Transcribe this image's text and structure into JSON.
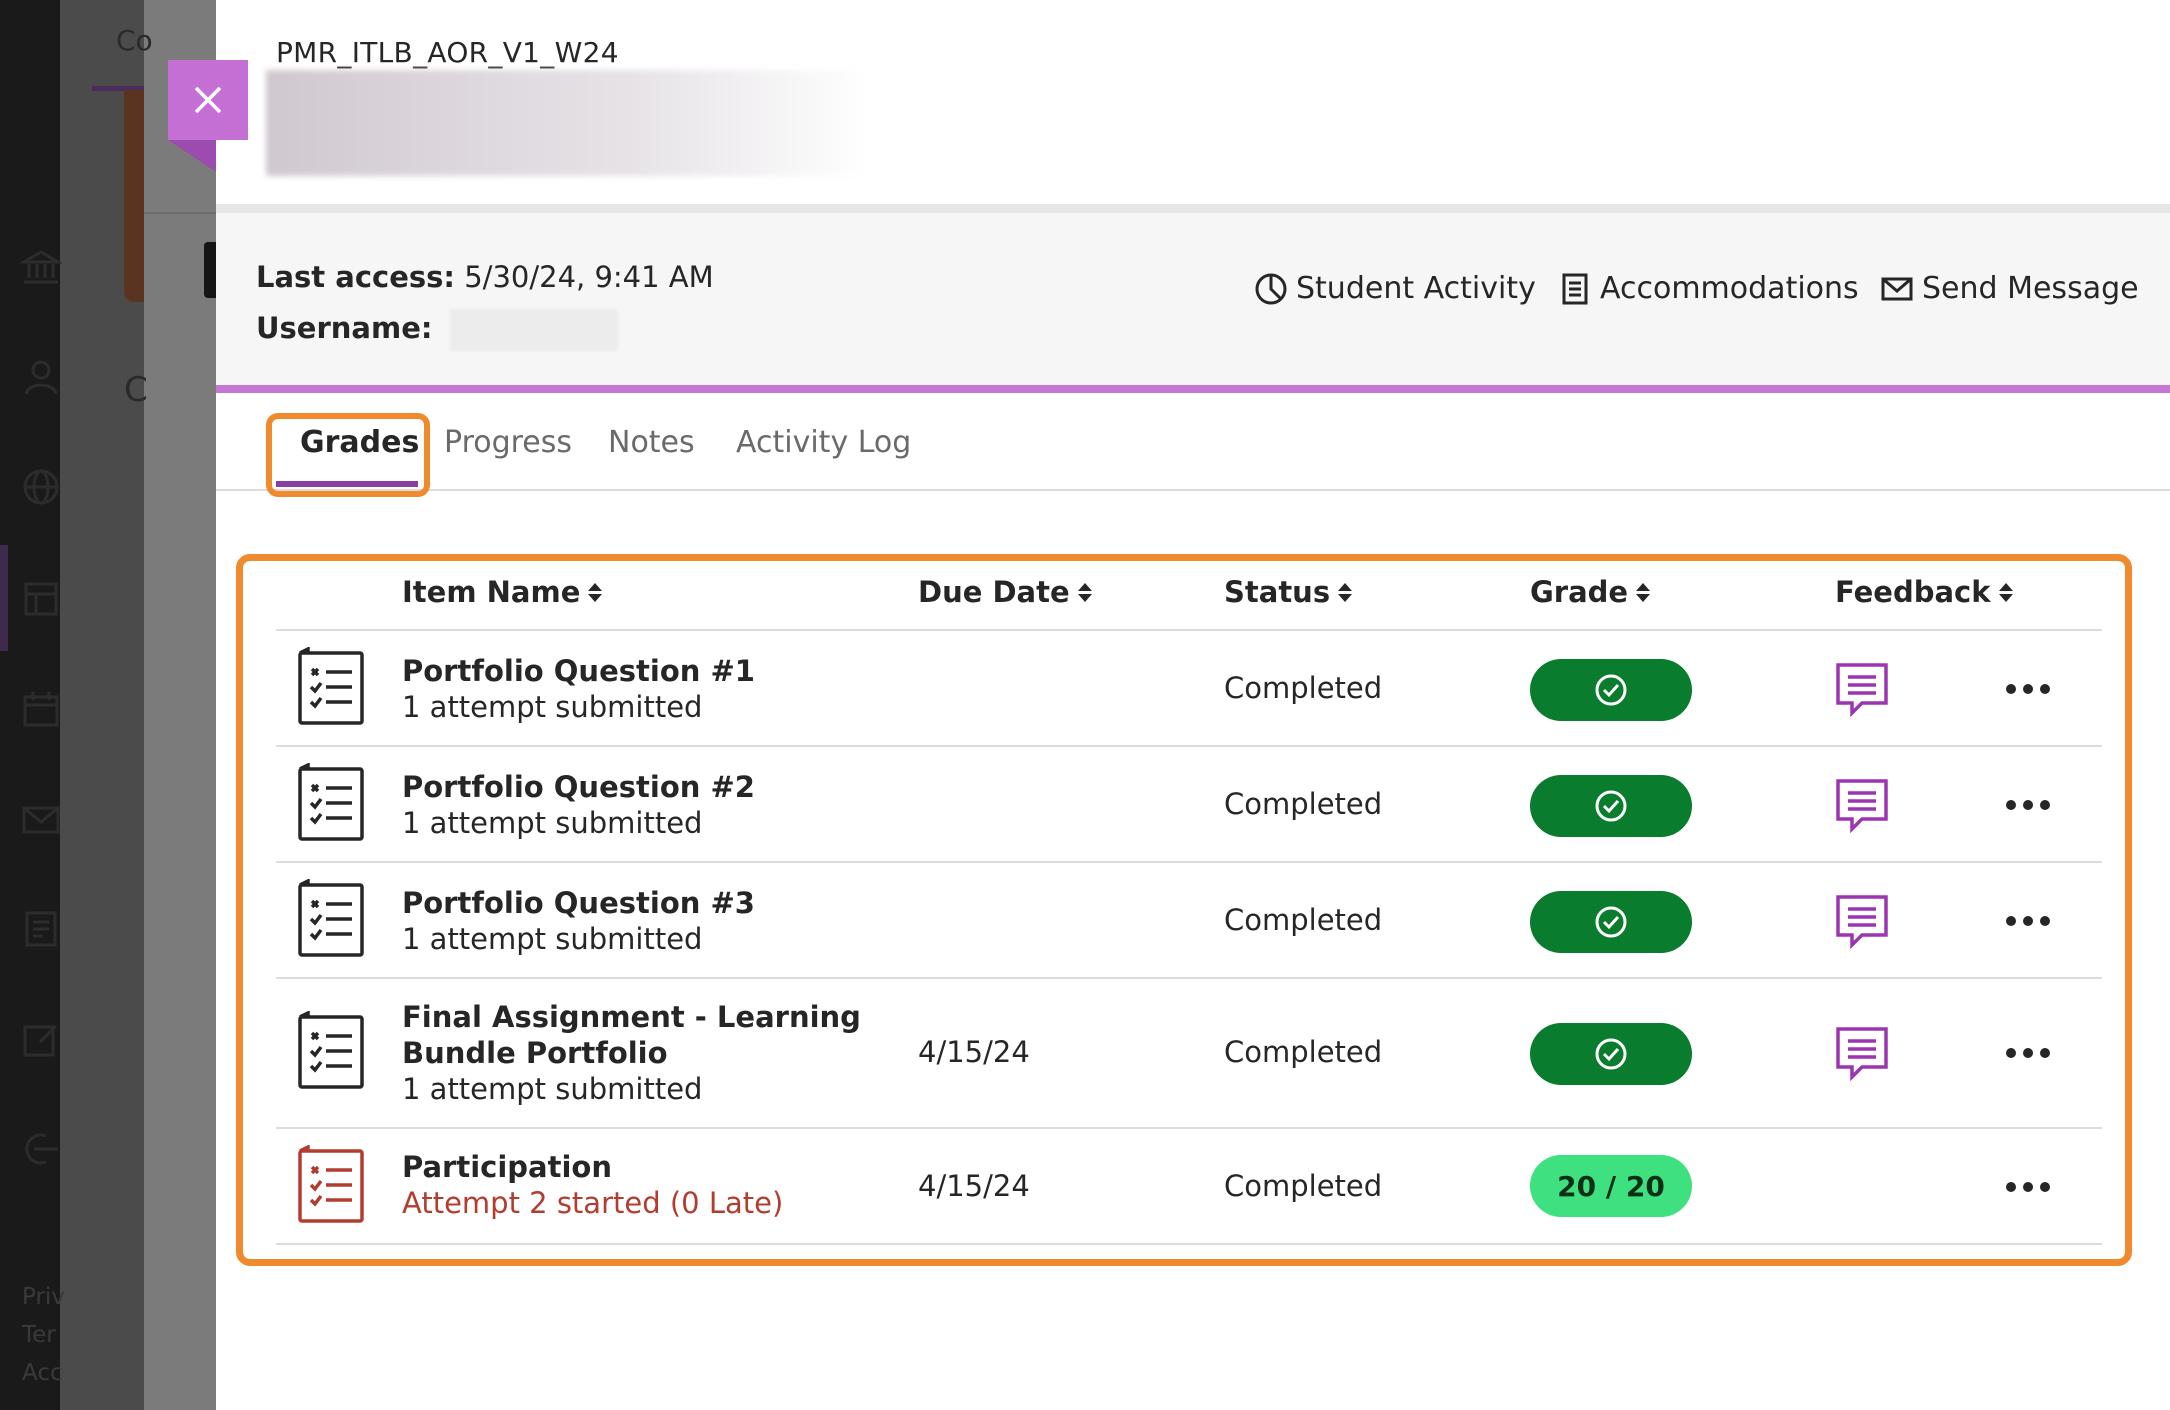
{
  "background_app": {
    "tab_text": "Co",
    "letter": "C",
    "footer_lines": [
      "Priv",
      "Ter",
      "Acc"
    ]
  },
  "panel": {
    "course_code": "PMR_ITLB_AOR_V1_W24",
    "close_icon": "close-icon",
    "last_access_label": "Last access:",
    "last_access_value": "5/30/24, 9:41 AM",
    "username_label": "Username:",
    "actions": {
      "student_activity": "Student Activity",
      "accommodations": "Accommodations",
      "send_message": "Send Message"
    },
    "tabs": {
      "grades": "Grades",
      "progress": "Progress",
      "notes": "Notes",
      "activity_log": "Activity Log"
    },
    "colors": {
      "accent_purple": "#c677d3",
      "highlight_orange": "#ef8a2d",
      "grade_green": "#0a7c2e",
      "score_green": "#3ee07f",
      "late_red": "#b23d2f"
    }
  },
  "grades_table": {
    "columns": {
      "item_name": "Item Name",
      "due_date": "Due Date",
      "status": "Status",
      "grade": "Grade",
      "feedback": "Feedback"
    },
    "rows": [
      {
        "name": "Portfolio Question #1",
        "sub": "1 attempt submitted",
        "due": "",
        "status": "Completed",
        "grade": "check",
        "feedback": true
      },
      {
        "name": "Portfolio Question #2",
        "sub": "1 attempt submitted",
        "due": "",
        "status": "Completed",
        "grade": "check",
        "feedback": true
      },
      {
        "name": "Portfolio Question #3",
        "sub": "1 attempt submitted",
        "due": "",
        "status": "Completed",
        "grade": "check",
        "feedback": true
      },
      {
        "name_line1": "Final Assignment - Learning",
        "name_line2": "Bundle Portfolio",
        "sub": "1 attempt submitted",
        "due": "4/15/24",
        "status": "Completed",
        "grade": "check",
        "feedback": true
      },
      {
        "name": "Participation",
        "sub": "Attempt 2 started (0 Late)",
        "due": "4/15/24",
        "status": "Completed",
        "grade": "20 / 20",
        "feedback": false
      }
    ]
  }
}
